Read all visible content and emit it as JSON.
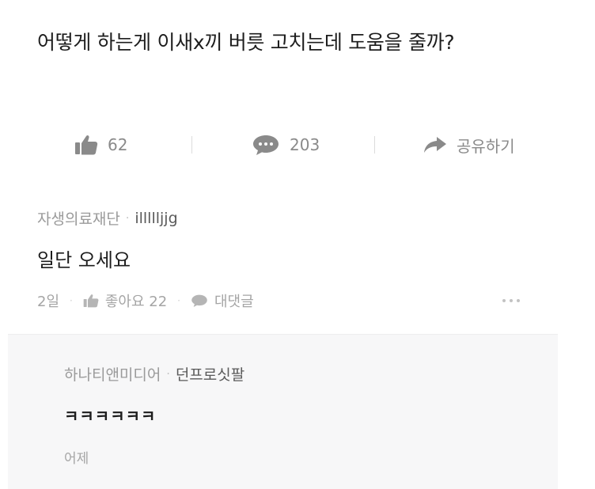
{
  "post": {
    "title": "어떻게 하는게 이새x끼 버릇 고치는데 도움을 줄까?"
  },
  "actions": {
    "like_count": "62",
    "comment_count": "203",
    "share_label": "공유하기"
  },
  "comment": {
    "company": "자생의료재단",
    "separator": "·",
    "nickname": "illllljjg",
    "text": "일단 오세요",
    "time": "2일",
    "like_label": "좋아요 22",
    "reply_label": "대댓글"
  },
  "reply": {
    "company": "하나티앤미디어",
    "separator": "·",
    "nickname": "던프로싯팔",
    "text": "ㅋㅋㅋㅋㅋㅋ",
    "time": "어제"
  },
  "colors": {
    "icon_gray": "#8a8a8a",
    "meta_gray": "#a5a5a5",
    "reply_bg": "#f7f7f8"
  },
  "icons": [
    "thumbs-up-icon",
    "speech-bubble-icon",
    "share-arrow-icon",
    "more-dots-icon"
  ]
}
